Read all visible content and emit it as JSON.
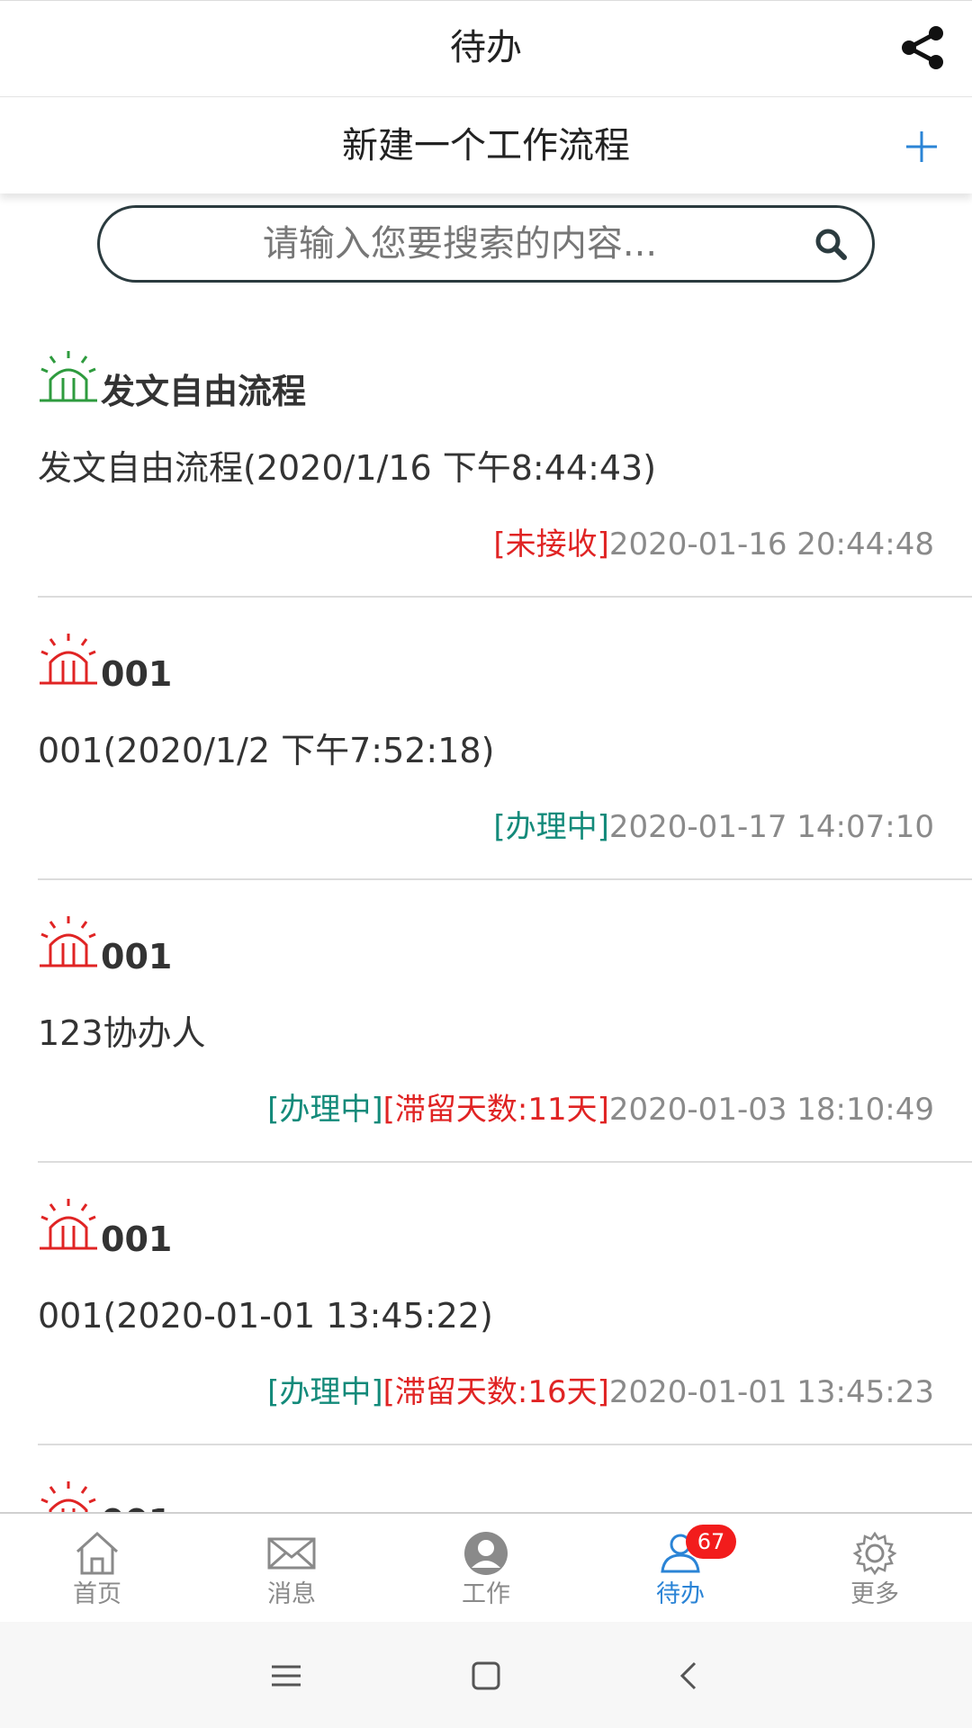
{
  "header": {
    "title": "待办",
    "share_icon": "share-icon"
  },
  "newbar": {
    "label": "新建一个工作流程",
    "plus_icon": "plus-icon",
    "accent": "#2b84d6"
  },
  "search": {
    "placeholder": "请输入您要搜索的内容...",
    "value": ""
  },
  "colors": {
    "red": "#e02424",
    "teal": "#138a7a",
    "green": "#2e9b3e",
    "gray": "#8a8a8a"
  },
  "items": [
    {
      "icon": "alarm-green-icon",
      "title": "发文自由流程",
      "subtitle": "发文自由流程(2020/1/16 下午8:44:43)",
      "status": "[未接收]",
      "delay": "",
      "time": "2020-01-16 20:44:48"
    },
    {
      "icon": "alarm-red-icon",
      "title": "001",
      "subtitle": "001(2020/1/2 下午7:52:18)",
      "status": "[办理中]",
      "delay": "",
      "time": "2020-01-17 14:07:10"
    },
    {
      "icon": "alarm-red-icon",
      "title": "001",
      "subtitle": "123协办人",
      "status": "[办理中]",
      "delay": "[滞留天数:11天]",
      "time": "2020-01-03 18:10:49"
    },
    {
      "icon": "alarm-red-icon",
      "title": "001",
      "subtitle": "001(2020-01-01 13:45:22)",
      "status": "[办理中]",
      "delay": "[滞留天数:16天]",
      "time": "2020-01-01 13:45:23"
    },
    {
      "icon": "alarm-red-icon",
      "title": "001",
      "subtitle": "",
      "status": "",
      "delay": "",
      "time": ""
    }
  ],
  "tabs": [
    {
      "label": "首页",
      "icon": "home-icon",
      "active": false
    },
    {
      "label": "消息",
      "icon": "mail-icon",
      "active": false
    },
    {
      "label": "工作",
      "icon": "person-circle-icon",
      "active": false
    },
    {
      "label": "待办",
      "icon": "user-todo-icon",
      "active": true,
      "badge": "67"
    },
    {
      "label": "更多",
      "icon": "gear-icon",
      "active": false
    }
  ],
  "system_nav": [
    "menu-icon",
    "home-square-icon",
    "back-icon"
  ]
}
